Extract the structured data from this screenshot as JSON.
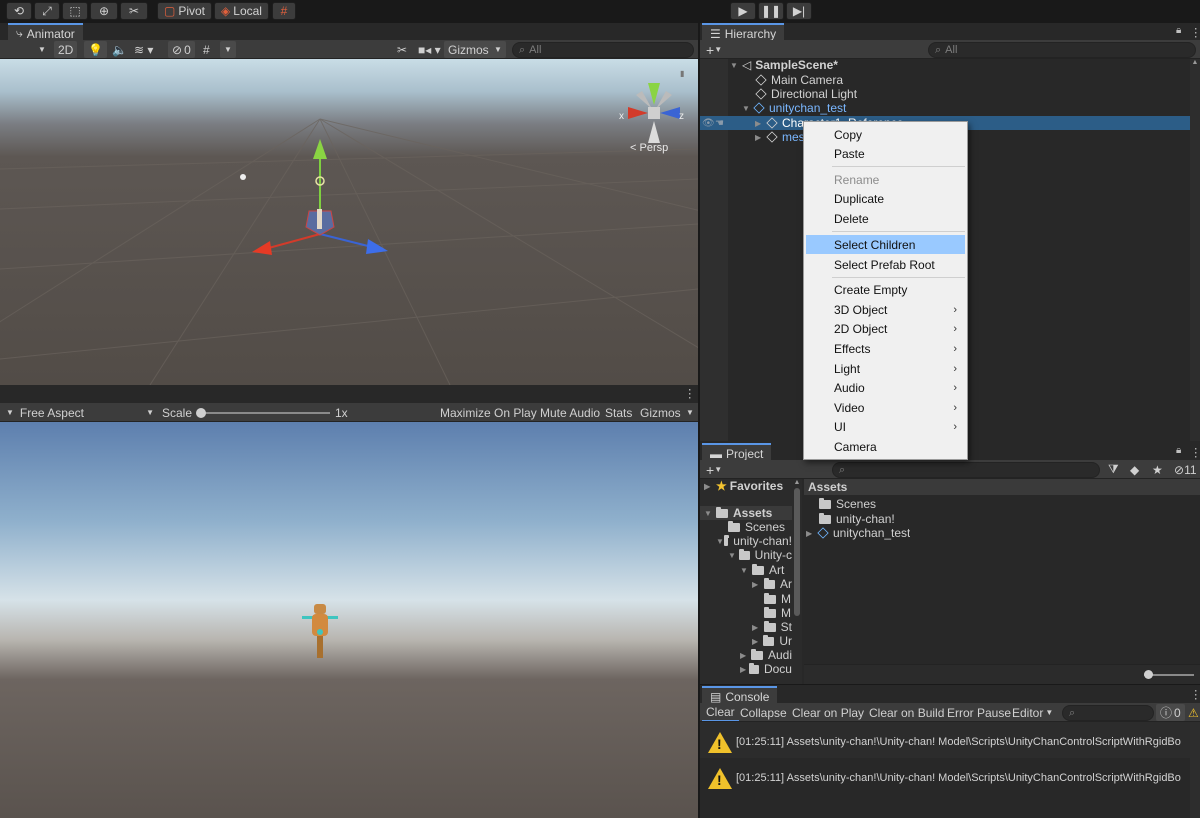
{
  "toolbar": {
    "pivot_label": "Pivot",
    "local_label": "Local"
  },
  "animator": {
    "tab_label": "Animator",
    "mode_2d": "2D",
    "hidden_count": "0",
    "gizmos_label": "Gizmos",
    "search_placeholder": "All",
    "persp_label": "Persp",
    "axis_x": "x",
    "axis_z": "z"
  },
  "game": {
    "aspect_label": "Free Aspect",
    "scale_label": "Scale",
    "scale_value": "1x",
    "maximize_label": "Maximize On Play",
    "mute_label": "Mute Audio",
    "stats_label": "Stats",
    "gizmos_label": "Gizmos"
  },
  "hierarchy": {
    "tab_label": "Hierarchy",
    "search_placeholder": "All",
    "scene_name": "SampleScene*",
    "items": [
      {
        "label": "Main Camera"
      },
      {
        "label": "Directional Light"
      },
      {
        "label": "unitychan_test"
      },
      {
        "label": "Character1_Reference"
      },
      {
        "label": "mesh"
      }
    ]
  },
  "context_menu": {
    "items": [
      {
        "label": "Copy"
      },
      {
        "label": "Paste"
      },
      {
        "label": "Rename"
      },
      {
        "label": "Duplicate"
      },
      {
        "label": "Delete"
      },
      {
        "label": "Select Children"
      },
      {
        "label": "Select Prefab Root"
      },
      {
        "label": "Create Empty"
      },
      {
        "label": "3D Object"
      },
      {
        "label": "2D Object"
      },
      {
        "label": "Effects"
      },
      {
        "label": "Light"
      },
      {
        "label": "Audio"
      },
      {
        "label": "Video"
      },
      {
        "label": "UI"
      },
      {
        "label": "Camera"
      }
    ]
  },
  "project": {
    "tab_label": "Project",
    "hidden_count": "11",
    "favorites_label": "Favorites",
    "tree": [
      {
        "label": "Assets"
      },
      {
        "label": "Scenes"
      },
      {
        "label": "unity-chan!"
      },
      {
        "label": "Unity-c"
      },
      {
        "label": "Art"
      },
      {
        "label": "Ar"
      },
      {
        "label": "M"
      },
      {
        "label": "M"
      },
      {
        "label": "St"
      },
      {
        "label": "Ur"
      },
      {
        "label": "Audi"
      },
      {
        "label": "Docu"
      }
    ],
    "assets_header": "Assets",
    "assets": [
      {
        "label": "Scenes"
      },
      {
        "label": "unity-chan!"
      },
      {
        "label": "unitychan_test"
      }
    ]
  },
  "console": {
    "tab_label": "Console",
    "clear_label": "Clear",
    "collapse_label": "Collapse",
    "clear_on_play_label": "Clear on Play",
    "clear_on_build_label": "Clear on Build",
    "error_pause_label": "Error Pause",
    "editor_label": "Editor",
    "error_count": "0",
    "messages": [
      {
        "text": "[01:25:11] Assets\\unity-chan!\\Unity-chan! Model\\Scripts\\UnityChanControlScriptWithRgidBo"
      },
      {
        "text": "[01:25:11] Assets\\unity-chan!\\Unity-chan! Model\\Scripts\\UnityChanControlScriptWithRgidBo"
      }
    ]
  }
}
